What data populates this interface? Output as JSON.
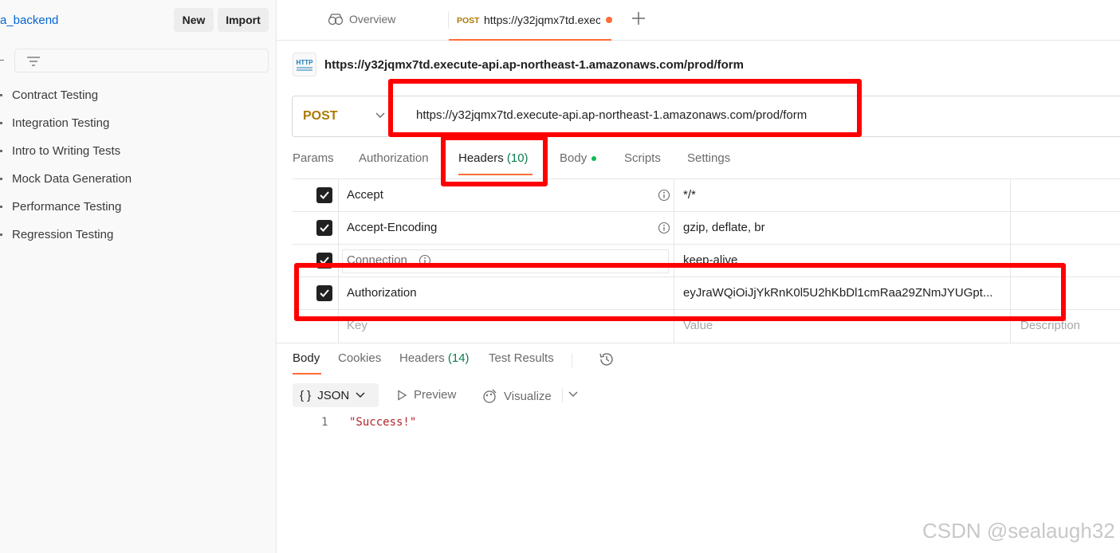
{
  "sidebar": {
    "workspace_name": "a_backend",
    "new_label": "New",
    "import_label": "Import",
    "items": [
      {
        "label": "Contract Testing"
      },
      {
        "label": "Integration Testing"
      },
      {
        "label": "Intro to Writing Tests"
      },
      {
        "label": "Mock Data Generation"
      },
      {
        "label": "Performance Testing"
      },
      {
        "label": "Regression Testing"
      }
    ]
  },
  "tabs": {
    "overview_label": "Overview",
    "request_method": "POST",
    "request_url": "https://y32jqmx7td.execute-api.ap-northeast-1.amazonaws.com/prod/form"
  },
  "request": {
    "icon_label": "HTTP",
    "title": "https://y32jqmx7td.execute-api.ap-northeast-1.amazonaws.com/prod/form",
    "method": "POST",
    "url": "https://y32jqmx7td.execute-api.ap-northeast-1.amazonaws.com/prod/form"
  },
  "request_tabs": {
    "params": "Params",
    "authorization": "Authorization",
    "headers": "Headers",
    "headers_count": "(10)",
    "body": "Body",
    "scripts": "Scripts",
    "settings": "Settings"
  },
  "headers_table": {
    "rows": [
      {
        "key": "Accept",
        "value": "*/*",
        "checked": true
      },
      {
        "key": "Accept-Encoding",
        "value": "gzip, deflate, br",
        "checked": true
      },
      {
        "key": "Connection",
        "value": "keep-alive",
        "checked": true
      },
      {
        "key": "Authorization",
        "value": "eyJraWQiOiJjYkRnK0l5U2hKbDl1cmRaa29ZNmJYUGpt...",
        "checked": true
      }
    ],
    "key_placeholder": "Key",
    "value_placeholder": "Value",
    "description_placeholder": "Description"
  },
  "response_tabs": {
    "body": "Body",
    "cookies": "Cookies",
    "headers": "Headers",
    "headers_count": "(14)",
    "test_results": "Test Results"
  },
  "response_toolbar": {
    "format": "JSON",
    "preview": "Preview",
    "visualize": "Visualize"
  },
  "response_body": {
    "line_number": "1",
    "content": "\"Success!\""
  },
  "watermark": "CSDN @sealaugh32",
  "colors": {
    "accent": "#ff6c37",
    "method_post": "#ad7a03",
    "annotation_red": "#ff0000",
    "link_blue": "#0265d2"
  }
}
